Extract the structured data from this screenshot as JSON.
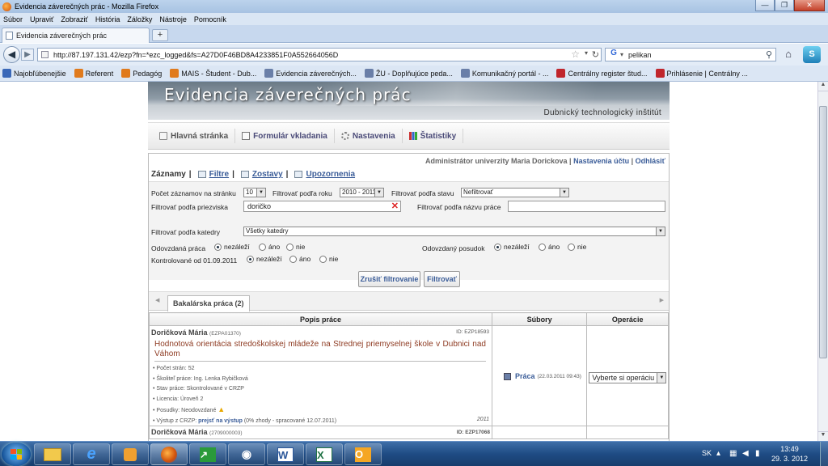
{
  "window": {
    "title": "Evidencia záverečných prác - Mozilla Firefox",
    "min": "—",
    "max": "❐",
    "close": "✕"
  },
  "menu": [
    "Súbor",
    "Upraviť",
    "Zobraziť",
    "História",
    "Záložky",
    "Nástroje",
    "Pomocník"
  ],
  "tab": {
    "label": "Evidencia záverečných prác",
    "new_tab": "+"
  },
  "nav": {
    "url": "http://87.197.131.42/ezp?fn=*ezc_logged&fs=A27D0F46BD8A4233851F0A552664056D",
    "search": "pelikan",
    "back_icon": "arrow-left-icon",
    "forward_icon": "arrow-right-icon"
  },
  "bookmarks": [
    {
      "label": "Najobľúbenejšie",
      "color": "#3a68b8"
    },
    {
      "label": "Referent",
      "color": "#e07a1c"
    },
    {
      "label": "Pedagóg",
      "color": "#e07a1c"
    },
    {
      "label": "MAIS - Študent - Dub...",
      "color": "#e07a1c"
    },
    {
      "label": "Evidencia záverečných...",
      "color": "#6a7fa8"
    },
    {
      "label": "ŽU - Doplňujúce peda...",
      "color": "#6a7fa8"
    },
    {
      "label": "Komunikačný portál - ...",
      "color": "#6a7fa8"
    },
    {
      "label": "Centrálny register štud...",
      "color": "#c0262c"
    },
    {
      "label": "Prihlásenie | Centrálny ...",
      "color": "#c0262c"
    }
  ],
  "site": {
    "banner_title": "Evidencia záverečných prác",
    "institute": "Dubnický technologický inštitút"
  },
  "topnav": [
    "Hlavná stránka",
    "Formulár vkladania",
    "Nastavenia",
    "Štatistiky"
  ],
  "user": {
    "text": "Administrátor univerzity Maria Dorickova",
    "sep1": "|",
    "account": "Nastavenia účtu",
    "sep2": "|",
    "logout": "Odhlásiť"
  },
  "toolbar": {
    "records": "Záznamy",
    "sep": "|",
    "filter": "Filtre",
    "reports": "Zostavy",
    "alerts": "Upozornenia"
  },
  "filters": {
    "per_page_label": "Počet záznamov na stránku",
    "per_page": "10",
    "year_label": "Filtrovať podľa roku",
    "year": "2010 - 2011",
    "state_label": "Filtrovať podľa stavu",
    "state": "Nefiltrovať",
    "surname_label": "Filtrovať podľa priezviska",
    "surname": "doričko",
    "title_label": "Filtrovať podľa názvu práce",
    "title": "",
    "dept_label": "Filtrovať podľa katedry",
    "dept": "Všetky katedry",
    "submitted_label": "Odovzdaná práca",
    "review_label": "Odovzdaný posudok",
    "checked_label": "Kontrolované od 01.09.2011",
    "opt_any": "nezáleží",
    "opt_yes": "áno",
    "opt_no": "nie",
    "reset_button": "Zrušiť filtrovanie",
    "filter_button": "Filtrovať"
  },
  "tabs": {
    "active": "Bakalárska práca (2)"
  },
  "table": {
    "headers": [
      "Popis práce",
      "Súbory",
      "Operácie"
    ],
    "rows": [
      {
        "author": "Doričková Mária",
        "code": "(EZPA01370)",
        "id": "ID: EZP18593",
        "title": "Hodnotová orientácia stredoškolskej mládeže na Strednej priemyselnej škole v Dubnici nad Váhom",
        "meta1": "• Počet strán: 52",
        "meta2": "• Školiteľ práce: Ing. Lenka Rybičková",
        "meta3": "• Stav práce: Skontrolované v CRZP",
        "meta4": "• Licencia: Úroveň 2",
        "meta5": "• Posudky: Neodovzdané",
        "meta6_prefix": "• Výstup z CRZP:",
        "meta6_link": "prejsť na výstup",
        "meta6_suffix": "(0% zhody - spracované 12.07.2011)",
        "year": "2011",
        "file_label": "Práca",
        "file_date": "(22.03.2011 09:43)",
        "operation": "Vyberte si operáciu"
      },
      {
        "author": "Doričková Mária",
        "code": "(2709000003)",
        "id": "ID: EZP17068"
      }
    ]
  },
  "taskbar": {
    "lang": "SK",
    "time": "13:49",
    "date": "29. 3. 2012"
  }
}
